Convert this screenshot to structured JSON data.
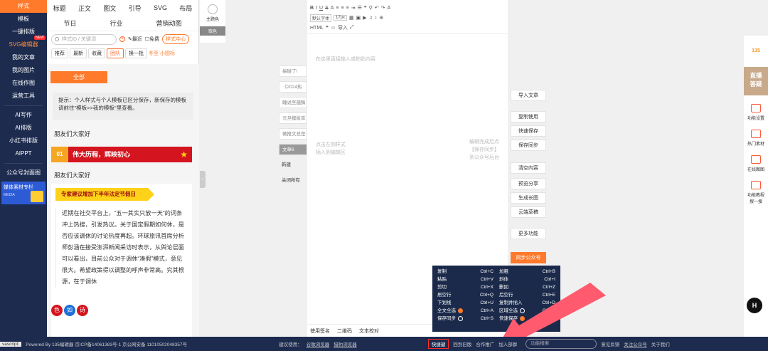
{
  "left_nav": {
    "items": [
      "样式",
      "模板",
      "一键排版",
      "SVG编辑器",
      "我的文章",
      "我的图片",
      "在线作图",
      "运营工具"
    ],
    "items2": [
      "AI写作",
      "AI排版",
      "小红书排版",
      "AIPPT"
    ],
    "items3": [
      "公众号封面图"
    ],
    "new_badge": "NEW",
    "media_title": "媒体素材专栏",
    "media_sub": "MEDIA"
  },
  "tabs_row1": [
    "标题",
    "正文",
    "图文",
    "引导",
    "SVG",
    "布局"
  ],
  "tabs_row2": [
    "节日",
    "行业",
    "营销动图"
  ],
  "search": {
    "placeholder": "样式ID / 关键词",
    "recent": "最近",
    "free": "免费",
    "center": "样式中心"
  },
  "filters": [
    "推荐",
    "最新",
    "收藏",
    "团队",
    "换一批",
    "冬至",
    "小图标"
  ],
  "all_btn": "全部",
  "tip": "提示：个人样式与个人模板已区分保存，新保存的模板请前往\"模板>>我的模板\"里查看。",
  "greet1": "朋友们大家好",
  "banner_num": "01",
  "banner_text": "伟大历程，辉映初心",
  "greet2": "朋友们大家好",
  "yellow_tag": "专家建议增加下半年法定节假日",
  "para": "近期在社交平台上，“五一其实只放一天”的词条冲上热搜，引发热议。关于国定假期如何休，是否应该调休的讨论热度再起。环球旅讯首席分析师彭涵在接受澎湃新闻采访时表示，从舆论层面可以看出，目前公众对于调休“凑假”模式，意见很大。希望政策得以调整的呼声非常高。究其根源，在于调休",
  "circles": [
    "色",
    "如",
    "诗"
  ],
  "color_col": {
    "title": "主题色",
    "btn": "取色"
  },
  "draft": [
    "搞碰了!",
    "《2024热",
    "睡说至蕴酶",
    "元旦模板库",
    "做推文总是",
    "文章6",
    "新建",
    "关闭所有"
  ],
  "toolbar": {
    "font": "默认字体",
    "size": "17px",
    "html": "HTML",
    "import": "导入"
  },
  "editor": {
    "placeholder": "在这里直接输入或粘贴内容",
    "hint_left": "点击左侧样式\n插入到编辑区",
    "hint_right": "编辑完成后点\n【保存同步】\n到公众号后台",
    "foot": [
      "使用签名",
      "二维码",
      "文本校对"
    ]
  },
  "right_panel": [
    "导入文章",
    "复制使用",
    "快速保存",
    "保存同步",
    "清空内容",
    "预览分享",
    "生成长图",
    "云端草稿",
    "更多功能",
    "同步公众号"
  ],
  "right_bar": {
    "logo": "135",
    "direct": "直播\n答疑",
    "items": [
      "功能设置",
      "热门素材",
      "在线图图",
      "功能教程\n搜一搜"
    ]
  },
  "shortcuts": [
    [
      "复制",
      "Ctrl+C",
      "加粗",
      "Ctrl+B"
    ],
    [
      "粘贴",
      "Ctrl+V",
      "斜体",
      "Ctrl+I"
    ],
    [
      "剪切",
      "Ctrl+X",
      "删回",
      "Ctrl+Z"
    ],
    [
      "居空行",
      "Ctrl+Q",
      "后空行",
      "Ctrl+E"
    ],
    [
      "下划线",
      "Ctrl+U",
      "复制并插入",
      "Ctrl+D"
    ],
    [
      "全文全选",
      "Ctrl+A",
      "区域全选",
      "Ctrl+A"
    ],
    [
      "保存同步",
      "Ctrl+S",
      "快速保存",
      "Ctrl+S"
    ]
  ],
  "footer": {
    "js": "vascript:",
    "copyright": "Powered By 135编辑器  京ICP备14061383号-1  京公网安备 11010502048357号",
    "advice": "建议使用：",
    "link1": "谷歌浏览器",
    "link2": "猎豹浏览器",
    "hotkey": "快捷键",
    "items": [
      "回到旧版",
      "合作推广",
      "加入部群"
    ],
    "search": "功能搜索",
    "feedback": "意见反馈",
    "follow": "关注公众号",
    "about": "关于我们"
  }
}
